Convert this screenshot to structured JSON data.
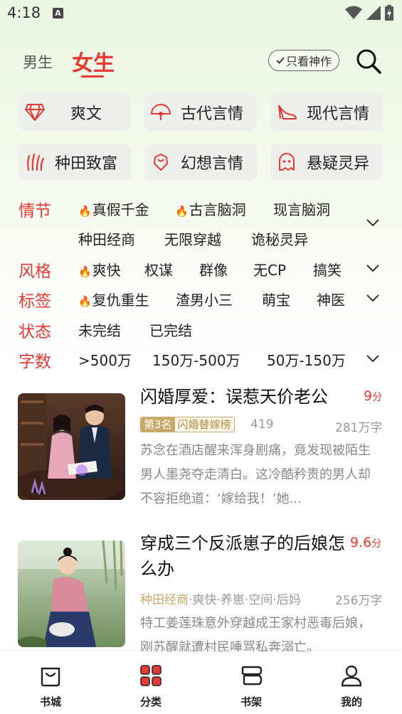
{
  "status": {
    "time": "4:18",
    "a_icon": "A"
  },
  "header": {
    "tab_male": "男生",
    "tab_female": "女生",
    "masterpiece_label": "只看神作",
    "search_icon": "search-icon"
  },
  "categories": [
    {
      "label": "爽文",
      "icon": "diamond-icon"
    },
    {
      "label": "古代言情",
      "icon": "fan-icon"
    },
    {
      "label": "现代言情",
      "icon": "high-heel-icon"
    },
    {
      "label": "种田致富",
      "icon": "crops-icon"
    },
    {
      "label": "幻想言情",
      "icon": "rose-icon"
    },
    {
      "label": "悬疑灵异",
      "icon": "ghost-icon"
    }
  ],
  "filters": {
    "plot": {
      "label": "情节",
      "items": [
        "真假千金",
        "古言脑洞",
        "现言脑洞",
        "种田经商",
        "无限穿越",
        "诡秘灵异"
      ]
    },
    "style": {
      "label": "风格",
      "items": [
        "爽快",
        "权谋",
        "群像",
        "无CP",
        "搞笑"
      ]
    },
    "tags": {
      "label": "标签",
      "items": [
        "复仇重生",
        "渣男小三",
        "萌宝",
        "神医"
      ]
    },
    "state": {
      "label": "状态",
      "items": [
        "未完结",
        "已完结"
      ]
    },
    "words": {
      "label": "字数",
      "items": [
        ">500万",
        "150万-500万",
        "50万-150万"
      ]
    }
  },
  "books": [
    {
      "title": "闪婚厚爱：误惹天价老公",
      "score": "9",
      "score_unit": "分",
      "rank": "第3名",
      "rank_list": "闪婚替嫁榜",
      "rank_value": "419",
      "word_count": "281万字",
      "desc": "苏念在酒店醒来浑身剧痛，竟发现被陌生男人墨尧夺走清白。这冷酷矜贵的男人却不容拒绝道：‘嫁给我！’她..."
    },
    {
      "title": "穿成三个反派崽子的后娘怎么办",
      "score": "9.6",
      "score_unit": "分",
      "tag_first": "种田经商",
      "tags_rest": "·爽快·养崽·空间·后妈",
      "word_count": "256万字",
      "desc": "特工姜莲珠意外穿越成王家村恶毒后娘，刚苏醒就遭村民唾骂私奔溺亡。"
    }
  ],
  "nav": [
    {
      "label": "书城",
      "icon": "bookstore-icon"
    },
    {
      "label": "分类",
      "icon": "category-icon"
    },
    {
      "label": "书架",
      "icon": "bookshelf-icon"
    },
    {
      "label": "我的",
      "icon": "profile-icon"
    }
  ],
  "colors": {
    "accent": "#e53935",
    "gold": "#c9a96b",
    "chip_bg": "#eef0ec"
  }
}
